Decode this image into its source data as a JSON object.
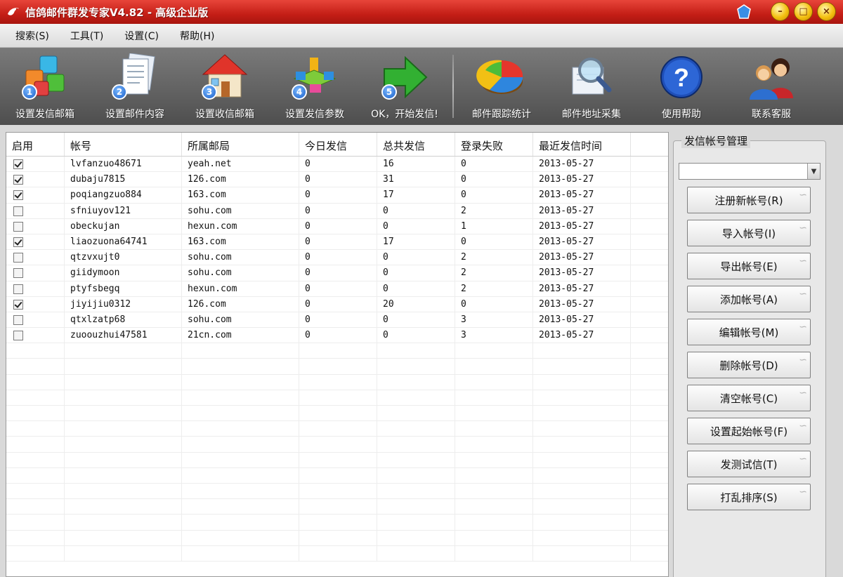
{
  "window": {
    "title": "信鸽邮件群发专家V4.82 - 高级企业版",
    "controls": [
      "–",
      "□",
      "×"
    ]
  },
  "menu": [
    "搜索(S)",
    "工具(T)",
    "设置(C)",
    "帮助(H)"
  ],
  "toolbar": {
    "steps": [
      {
        "badge": "1",
        "label": "设置发信邮箱",
        "icon": "cubes-icon"
      },
      {
        "badge": "2",
        "label": "设置邮件内容",
        "icon": "document-icon"
      },
      {
        "badge": "3",
        "label": "设置收信邮箱",
        "icon": "house-icon"
      },
      {
        "badge": "4",
        "label": "设置发信参数",
        "icon": "network-icon"
      },
      {
        "badge": "5",
        "label": "OK，开始发信!",
        "icon": "arrow-right-icon"
      }
    ],
    "tools": [
      {
        "label": "邮件跟踪统计",
        "icon": "pie-chart-icon"
      },
      {
        "label": "邮件地址采集",
        "icon": "magnifier-icon"
      },
      {
        "label": "使用帮助",
        "icon": "help-icon"
      },
      {
        "label": "联系客服",
        "icon": "users-icon"
      }
    ]
  },
  "table": {
    "columns": [
      "启用",
      "帐号",
      "所属邮局",
      "今日发信",
      "总共发信",
      "登录失败",
      "最近发信时间"
    ],
    "rows": [
      {
        "enabled": true,
        "account": "lvfanzuo48671",
        "domain": "yeah.net",
        "today": "0",
        "total": "16",
        "fail": "0",
        "last": "2013-05-27"
      },
      {
        "enabled": true,
        "account": "dubaju7815",
        "domain": "126.com",
        "today": "0",
        "total": "31",
        "fail": "0",
        "last": "2013-05-27"
      },
      {
        "enabled": true,
        "account": "poqiangzuo884",
        "domain": "163.com",
        "today": "0",
        "total": "17",
        "fail": "0",
        "last": "2013-05-27"
      },
      {
        "enabled": false,
        "account": "sfniuyov121",
        "domain": "sohu.com",
        "today": "0",
        "total": "0",
        "fail": "2",
        "last": "2013-05-27"
      },
      {
        "enabled": false,
        "account": "obeckujan",
        "domain": "hexun.com",
        "today": "0",
        "total": "0",
        "fail": "1",
        "last": "2013-05-27"
      },
      {
        "enabled": true,
        "account": "liaozuona64741",
        "domain": "163.com",
        "today": "0",
        "total": "17",
        "fail": "0",
        "last": "2013-05-27"
      },
      {
        "enabled": false,
        "account": "qtzvxujt0",
        "domain": "sohu.com",
        "today": "0",
        "total": "0",
        "fail": "2",
        "last": "2013-05-27"
      },
      {
        "enabled": false,
        "account": "giidymoon",
        "domain": "sohu.com",
        "today": "0",
        "total": "0",
        "fail": "2",
        "last": "2013-05-27"
      },
      {
        "enabled": false,
        "account": "ptyfsbegq",
        "domain": "hexun.com",
        "today": "0",
        "total": "0",
        "fail": "2",
        "last": "2013-05-27"
      },
      {
        "enabled": true,
        "account": "jiyijiu0312",
        "domain": "126.com",
        "today": "0",
        "total": "20",
        "fail": "0",
        "last": "2013-05-27"
      },
      {
        "enabled": false,
        "account": "qtxlzatp68",
        "domain": "sohu.com",
        "today": "0",
        "total": "0",
        "fail": "3",
        "last": "2013-05-27"
      },
      {
        "enabled": false,
        "account": "zuoouzhui47581",
        "domain": "21cn.com",
        "today": "0",
        "total": "0",
        "fail": "3",
        "last": "2013-05-27"
      }
    ]
  },
  "panel": {
    "title": "发信帐号管理",
    "combo_value": "",
    "buttons": [
      "注册新帐号(R)",
      "导入帐号(I)",
      "导出帐号(E)",
      "添加帐号(A)",
      "编辑帐号(M)",
      "删除帐号(D)",
      "清空帐号(C)",
      "设置起始帐号(F)",
      "发测试信(T)",
      "打乱排序(S)"
    ]
  },
  "colors": {
    "titlebar": "#c41e16",
    "toolbar": "#5c5c5c",
    "badge": "#1a5fc8"
  }
}
